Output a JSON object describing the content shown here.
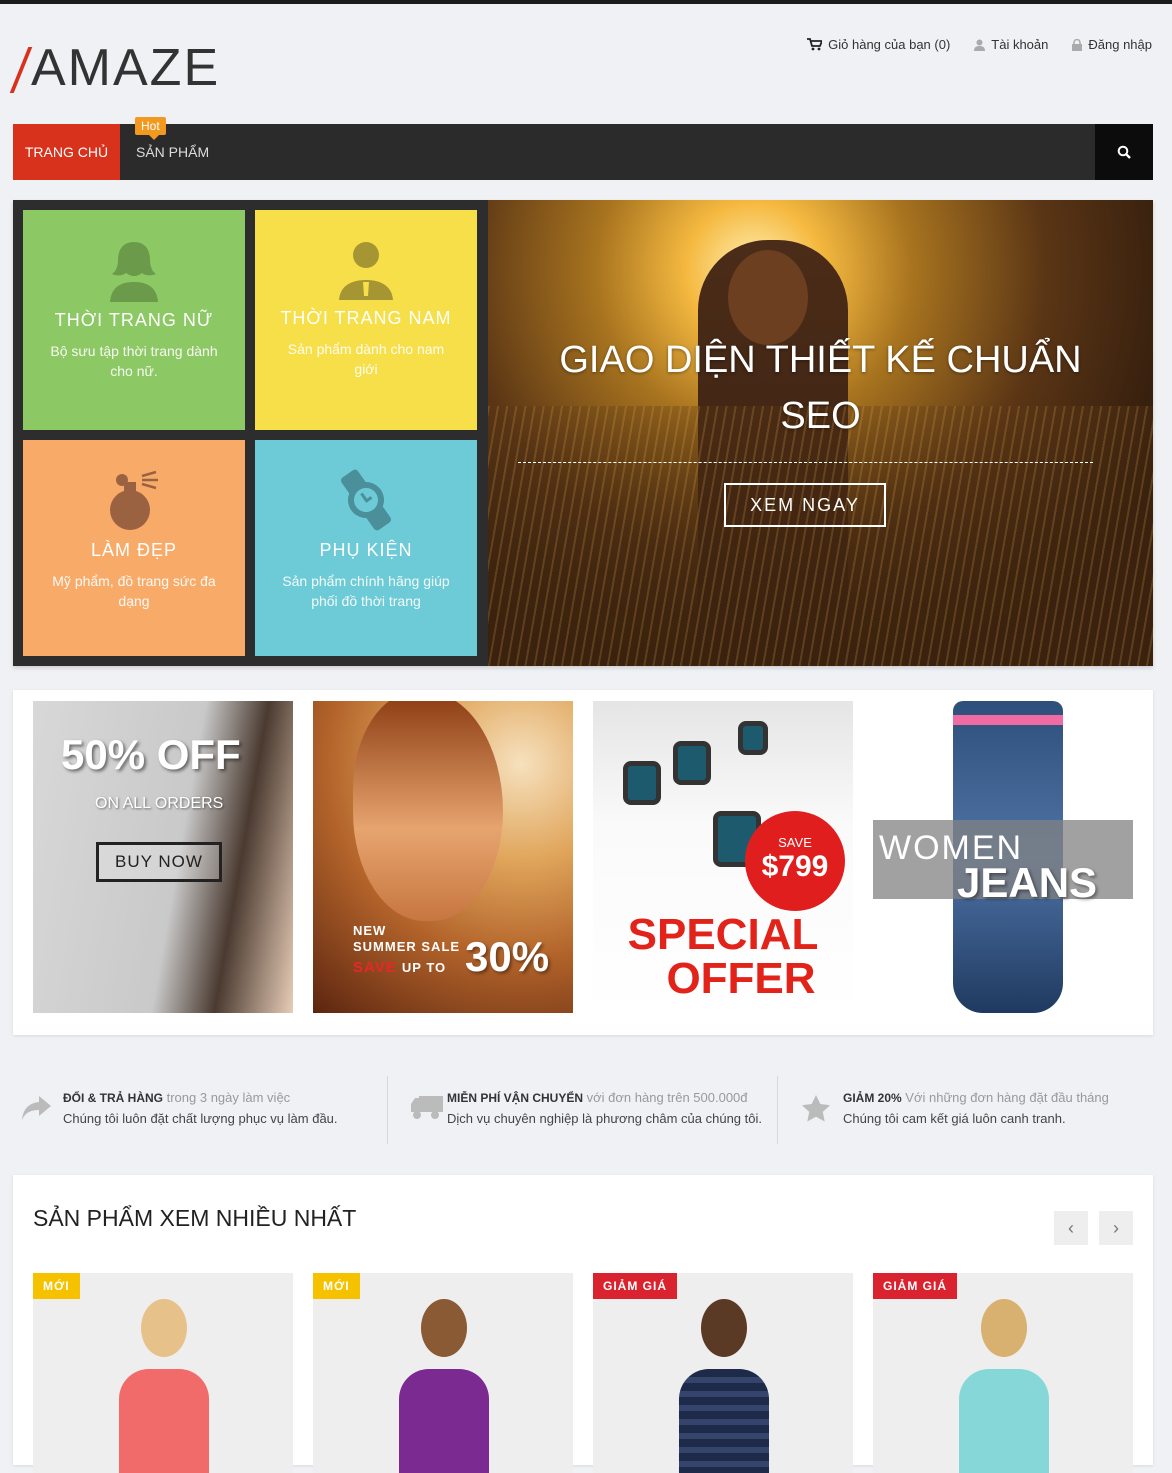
{
  "header": {
    "logo_text": "AMAZE",
    "cart": "Giỏ hàng của bạn (0)",
    "account": "Tài khoản",
    "login": "Đăng nhập"
  },
  "nav": {
    "home": "TRANG CHỦ",
    "products": "SẢN PHẨM",
    "hot_badge": "Hot"
  },
  "categories": [
    {
      "title": "THỜI TRANG NỮ",
      "desc": "Bộ sưu tập thời trang dành cho nữ.",
      "color": "#8cc864"
    },
    {
      "title": "THỜI TRANG NAM",
      "desc": "Sản phẩm dành cho nam giới",
      "color": "#f6df48"
    },
    {
      "title": "LÀM ĐẸP",
      "desc": "Mỹ phẩm, đồ trang sức đa dạng",
      "color": "#f8ab69"
    },
    {
      "title": "PHỤ KIỆN",
      "desc": "Sản phẩm chính hãng giúp phối đồ thời trang",
      "color": "#6ccbd6"
    }
  ],
  "slider": {
    "heading": "GIAO DIỆN THIẾT KẾ CHUẨN SEO",
    "button": "XEM NGAY"
  },
  "banners": {
    "b1": {
      "big": "50% OFF",
      "small": "ON ALL ORDERS",
      "button": "BUY NOW"
    },
    "b2": {
      "line1": "NEW",
      "line2": "SUMMER SALE",
      "line3a": "SAVE",
      "line3b": "UP TO",
      "percent": "30%"
    },
    "b3": {
      "save": "SAVE",
      "price": "$799",
      "line1": "SPECIAL",
      "line2": "OFFER"
    },
    "b4": {
      "line1": "WOMEN",
      "line2": "JEANS"
    }
  },
  "features": [
    {
      "bold": "ĐỔI & TRẢ HÀNG",
      "rest": " trong 3 ngày làm việc",
      "line2": "Chúng tôi luôn đặt chất lượng phục vụ làm đầu.",
      "icon": "share-arrow-icon"
    },
    {
      "bold": "MIỄN PHÍ VẬN CHUYỂN",
      "rest": " với đơn hàng trên 500.000đ",
      "line2": "Dịch vụ chuyên nghiệp là phương châm của chúng tôi.",
      "icon": "truck-icon"
    },
    {
      "bold": "GIẢM 20%",
      "rest": " Với những đơn hàng đặt đầu tháng",
      "line2": "Chúng tôi cam kết giá luôn canh tranh.",
      "icon": "star-icon"
    }
  ],
  "products_section": {
    "title": "SẢN PHẨM XEM NHIỀU NHẤT",
    "prev": "‹",
    "next": "›",
    "cards": [
      {
        "tag": "MỚI",
        "tag_color": "#f6c200"
      },
      {
        "tag": "MỚI",
        "tag_color": "#f6c200"
      },
      {
        "tag": "GIẢM GIÁ",
        "tag_color": "#d92430"
      },
      {
        "tag": "GIẢM GIÁ",
        "tag_color": "#d92430"
      }
    ]
  },
  "colors": {
    "accent": "#d8311c",
    "nav_bg": "#2b2b2b",
    "hot": "#f29a20"
  }
}
